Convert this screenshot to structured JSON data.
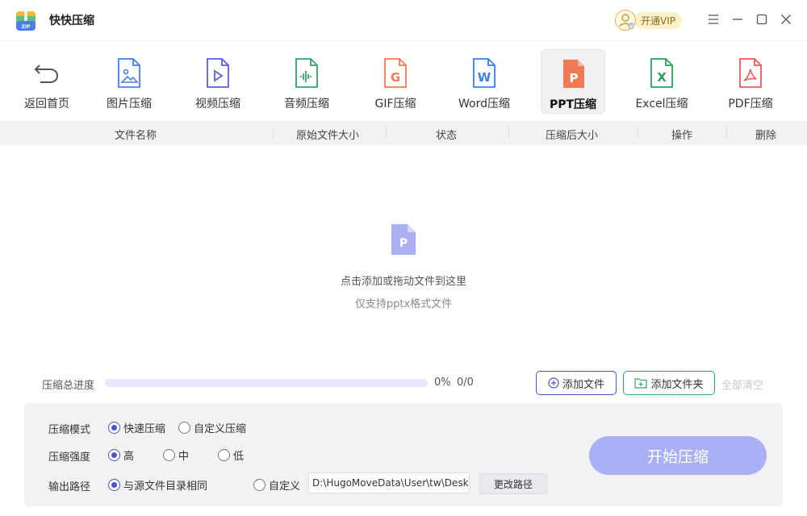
{
  "app": {
    "title": "快快压缩",
    "logo_text": "ZIP"
  },
  "vip": {
    "label": "开通VIP"
  },
  "window_controls": [
    "menu-icon",
    "minimize-icon",
    "maximize-icon",
    "close-icon"
  ],
  "toolbar": {
    "items": [
      {
        "label": "返回首页",
        "icon": "back-arrow-icon"
      },
      {
        "label": "图片压缩",
        "icon": "image-file-icon"
      },
      {
        "label": "视频压缩",
        "icon": "video-file-icon"
      },
      {
        "label": "音频压缩",
        "icon": "audio-file-icon"
      },
      {
        "label": "GIF压缩",
        "icon": "gif-file-icon",
        "glyph": "G"
      },
      {
        "label": "Word压缩",
        "icon": "word-file-icon",
        "glyph": "W"
      },
      {
        "label": "PPT压缩",
        "icon": "ppt-file-icon",
        "glyph": "P",
        "active": true
      },
      {
        "label": "Excel压缩",
        "icon": "excel-file-icon",
        "glyph": "X"
      },
      {
        "label": "PDF压缩",
        "icon": "pdf-file-icon"
      }
    ]
  },
  "table": {
    "columns": [
      "文件名称",
      "原始文件大小",
      "状态",
      "压缩后大小",
      "操作",
      "删除"
    ]
  },
  "dropzone": {
    "glyph": "P",
    "main_text": "点击添加或拖动文件到这里",
    "sub_text": "仅支持pptx格式文件"
  },
  "progress": {
    "label": "压缩总进度",
    "percent_text": "0%",
    "percent_value": 0,
    "count_text": "0/0"
  },
  "actions": {
    "add_file": "添加文件",
    "add_folder": "添加文件夹",
    "clear_all": "全部清空"
  },
  "settings": {
    "mode": {
      "label": "压缩模式",
      "options": [
        "快速压缩",
        "自定义压缩"
      ],
      "selected": 0
    },
    "strength": {
      "label": "压缩强度",
      "options": [
        "高",
        "中",
        "低"
      ],
      "selected": 0
    },
    "output": {
      "label": "输出路径",
      "options": [
        "与源文件目录相同",
        "自定义"
      ],
      "selected": 0,
      "path": "D:\\HugoMoveData\\User\\tw\\Desk",
      "change_button": "更改路径"
    },
    "start_button": "开始压缩"
  },
  "colors": {
    "accent": "#4a55c8",
    "start_button": "#a9b0f3",
    "progress_track": "#e6e8fb",
    "ppt_orange": "#f07a55",
    "vip_gold": "#e6b54a"
  }
}
